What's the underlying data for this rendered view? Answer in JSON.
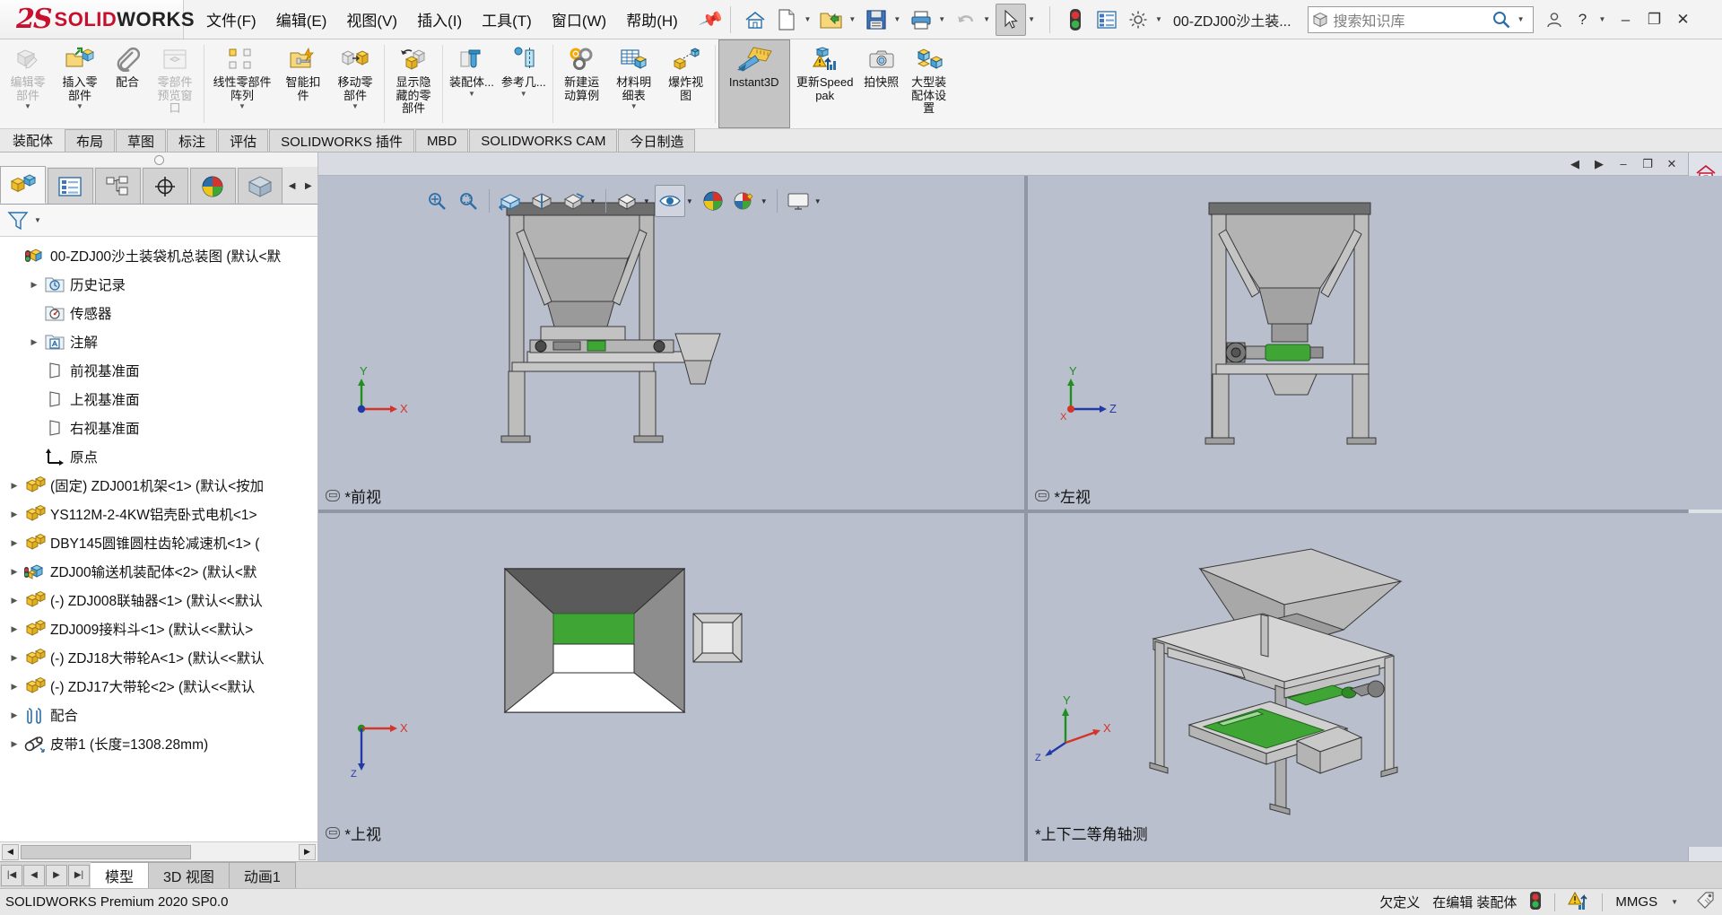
{
  "app": {
    "brand_mark": "2S",
    "brand_a": "SOLID",
    "brand_b": "WORKS",
    "document_title": "00-ZDJ00沙土装...",
    "version_status": "SOLIDWORKS Premium 2020 SP0.0"
  },
  "menu": [
    {
      "label": "文件(F)",
      "name": "menu-file"
    },
    {
      "label": "编辑(E)",
      "name": "menu-edit"
    },
    {
      "label": "视图(V)",
      "name": "menu-view"
    },
    {
      "label": "插入(I)",
      "name": "menu-insert"
    },
    {
      "label": "工具(T)",
      "name": "menu-tools"
    },
    {
      "label": "窗口(W)",
      "name": "menu-window"
    },
    {
      "label": "帮助(H)",
      "name": "menu-help"
    }
  ],
  "quick_access": [
    {
      "name": "home-icon",
      "tooltip": "主页"
    },
    {
      "name": "new-document-icon",
      "tooltip": "新建"
    },
    {
      "name": "open-folder-icon",
      "tooltip": "打开"
    },
    {
      "name": "save-icon",
      "tooltip": "保存"
    },
    {
      "name": "print-icon",
      "tooltip": "打印"
    },
    {
      "name": "undo-icon",
      "tooltip": "撤销"
    },
    {
      "name": "select-arrow-icon",
      "tooltip": "选择"
    },
    {
      "name": "rebuild-icon",
      "tooltip": "重建模型"
    },
    {
      "name": "options-list-icon",
      "tooltip": "显示"
    },
    {
      "name": "gear-icon",
      "tooltip": "选项"
    }
  ],
  "search": {
    "placeholder": "搜索知识库",
    "icon": "box-search-icon"
  },
  "window_controls": {
    "user": "user-icon",
    "help": "help-icon",
    "minimize": "–",
    "maximize": "❐",
    "close": "✕"
  },
  "ribbon": {
    "items": [
      {
        "label": "编辑零部件",
        "name": "ribbon-edit-component",
        "icon": "edit-component-icon",
        "disabled": true,
        "dropdown": true
      },
      {
        "label": "插入零部件",
        "name": "ribbon-insert-component",
        "icon": "insert-component-icon",
        "dropdown": true
      },
      {
        "label": "配合",
        "name": "ribbon-mate",
        "icon": "mate-paperclip-icon",
        "dropdown": false
      },
      {
        "label": "零部件预览窗口",
        "name": "ribbon-component-preview",
        "icon": "component-preview-icon",
        "disabled": true
      },
      {
        "label": "线性零部件阵列",
        "name": "ribbon-linear-pattern",
        "icon": "linear-pattern-icon",
        "dropdown": true
      },
      {
        "label": "智能扣件",
        "name": "ribbon-smart-fasteners",
        "icon": "smart-fastener-icon"
      },
      {
        "label": "移动零部件",
        "name": "ribbon-move-component",
        "icon": "move-component-icon",
        "dropdown": true
      },
      {
        "label": "显示隐藏的零部件",
        "name": "ribbon-show-hidden",
        "icon": "show-hidden-components-icon"
      },
      {
        "label": "装配体...",
        "name": "ribbon-assembly-features",
        "icon": "assembly-feature-icon",
        "dropdown": true
      },
      {
        "label": "参考几...",
        "name": "ribbon-reference-geometry",
        "icon": "reference-geometry-icon",
        "dropdown": true
      },
      {
        "label": "新建运动算例",
        "name": "ribbon-new-motion-study",
        "icon": "motion-study-icon"
      },
      {
        "label": "材料明细表",
        "name": "ribbon-bill-of-materials",
        "icon": "bom-table-icon",
        "dropdown": true
      },
      {
        "label": "爆炸视图",
        "name": "ribbon-exploded-view",
        "icon": "exploded-view-icon"
      },
      {
        "label": "Instant3D",
        "name": "ribbon-instant3d",
        "icon": "instant3d-ruler-icon",
        "active": true
      },
      {
        "label": "更新Speedpak",
        "name": "ribbon-update-speedpak",
        "icon": "update-speedpak-icon"
      },
      {
        "label": "拍快照",
        "name": "ribbon-take-snapshot",
        "icon": "camera-icon"
      },
      {
        "label": "大型装配体设置",
        "name": "ribbon-large-assembly-settings",
        "icon": "large-assembly-icon"
      }
    ]
  },
  "command_tabs": [
    {
      "label": "装配体",
      "name": "tab-assembly",
      "selected": false,
      "plain": true
    },
    {
      "label": "布局",
      "name": "tab-layout",
      "selected": false
    },
    {
      "label": "草图",
      "name": "tab-sketch",
      "selected": false
    },
    {
      "label": "标注",
      "name": "tab-markup",
      "selected": false
    },
    {
      "label": "评估",
      "name": "tab-evaluate",
      "selected": false
    },
    {
      "label": "SOLIDWORKS 插件",
      "name": "tab-solidworks-addins",
      "selected": false
    },
    {
      "label": "MBD",
      "name": "tab-mbd",
      "selected": false
    },
    {
      "label": "SOLIDWORKS CAM",
      "name": "tab-solidworks-cam",
      "selected": false
    },
    {
      "label": "今日制造",
      "name": "tab-manufacturing-today",
      "selected": false
    }
  ],
  "left_panel": {
    "tabs": [
      {
        "name": "feature-manager-tab",
        "icon": "assembly-tree-icon",
        "selected": true
      },
      {
        "name": "property-manager-tab",
        "icon": "property-list-icon",
        "selected": false
      },
      {
        "name": "configuration-manager-tab",
        "icon": "configuration-icon",
        "selected": false
      },
      {
        "name": "dimxpert-manager-tab",
        "icon": "dimxpert-target-icon",
        "selected": false
      },
      {
        "name": "display-manager-tab",
        "icon": "display-sphere-icon",
        "selected": false
      },
      {
        "name": "appearance-tab",
        "icon": "appearance-cube-icon",
        "selected": false
      }
    ],
    "filter": {
      "name": "filter-funnel-icon",
      "label": ""
    },
    "tree": [
      {
        "label": "00-ZDJ00沙土装袋机总装图  (默认<默",
        "icon": "assembly-root-icon",
        "arrow": false,
        "level": 0,
        "name": "tree-root"
      },
      {
        "label": "历史记录",
        "icon": "history-folder-icon",
        "arrow": true,
        "level": 1,
        "name": "tree-history"
      },
      {
        "label": "传感器",
        "icon": "sensors-folder-icon",
        "arrow": false,
        "level": 1,
        "name": "tree-sensors"
      },
      {
        "label": "注解",
        "icon": "annotations-folder-icon",
        "arrow": true,
        "level": 1,
        "name": "tree-annotations"
      },
      {
        "label": "前视基准面",
        "icon": "plane-icon",
        "arrow": false,
        "level": 1,
        "name": "tree-front-plane"
      },
      {
        "label": "上视基准面",
        "icon": "plane-icon",
        "arrow": false,
        "level": 1,
        "name": "tree-top-plane"
      },
      {
        "label": "右视基准面",
        "icon": "plane-icon",
        "arrow": false,
        "level": 1,
        "name": "tree-right-plane"
      },
      {
        "label": "原点",
        "icon": "origin-icon",
        "arrow": false,
        "level": 1,
        "name": "tree-origin"
      },
      {
        "label": "(固定) ZDJ001机架<1> (默认<按加",
        "icon": "part-icon",
        "arrow": true,
        "level": 0,
        "name": "tree-part-frame"
      },
      {
        "label": "YS112M-2-4KW铝壳卧式电机<1>",
        "icon": "part-icon",
        "arrow": true,
        "level": 0,
        "name": "tree-part-motor"
      },
      {
        "label": "DBY145圆锥圆柱齿轮减速机<1> (",
        "icon": "part-icon",
        "arrow": true,
        "level": 0,
        "name": "tree-part-reducer"
      },
      {
        "label": "ZDJ00输送机装配体<2> (默认<默",
        "icon": "subassembly-icon",
        "arrow": true,
        "level": 0,
        "name": "tree-subassembly-conveyor"
      },
      {
        "label": "(-) ZDJ008联轴器<1> (默认<<默认",
        "icon": "part-icon",
        "arrow": true,
        "level": 0,
        "name": "tree-part-coupling"
      },
      {
        "label": "ZDJ009接料斗<1> (默认<<默认>",
        "icon": "part-icon",
        "arrow": true,
        "level": 0,
        "name": "tree-part-hopper"
      },
      {
        "label": "(-) ZDJ18大带轮A<1> (默认<<默认",
        "icon": "part-icon",
        "arrow": true,
        "level": 0,
        "name": "tree-part-pulley-a"
      },
      {
        "label": "(-) ZDJ17大带轮<2> (默认<<默认",
        "icon": "part-icon",
        "arrow": true,
        "level": 0,
        "name": "tree-part-pulley"
      },
      {
        "label": "配合",
        "icon": "mates-folder-icon",
        "arrow": true,
        "level": 0,
        "name": "tree-mates"
      },
      {
        "label": "皮带1 (长度=1308.28mm)",
        "icon": "belt-icon",
        "arrow": true,
        "level": 0,
        "name": "tree-belt"
      }
    ]
  },
  "heads_up_toolbar": [
    {
      "name": "zoom-to-fit-icon"
    },
    {
      "name": "zoom-to-area-icon"
    },
    {
      "name": "previous-view-icon"
    },
    {
      "name": "section-view-icon"
    },
    {
      "name": "view-orientation-icon"
    },
    {
      "name": "display-style-icon"
    },
    {
      "name": "hide-show-items-icon"
    },
    {
      "name": "edit-appearance-icon"
    },
    {
      "name": "apply-scene-icon"
    },
    {
      "name": "view-settings-icon"
    }
  ],
  "viewports": [
    {
      "name": "viewport-front",
      "label": "*前视",
      "locked": true
    },
    {
      "name": "viewport-left",
      "label": "*左视",
      "locked": true
    },
    {
      "name": "viewport-top",
      "label": "*上视",
      "locked": true
    },
    {
      "name": "viewport-isometric",
      "label": "*上下二等角轴测",
      "locked": false
    }
  ],
  "triads": [
    {
      "viewport": "front",
      "axes": [
        "Y",
        "X"
      ]
    },
    {
      "viewport": "left",
      "axes": [
        "Y",
        "Z",
        "X"
      ]
    },
    {
      "viewport": "top",
      "axes": [
        "X",
        "Z"
      ]
    },
    {
      "viewport": "iso",
      "axes": [
        "Y",
        "X",
        "Z"
      ]
    }
  ],
  "task_pane": [
    {
      "name": "home-task-icon"
    },
    {
      "name": "design-library-icon"
    },
    {
      "name": "file-explorer-icon"
    },
    {
      "name": "view-palette-icon"
    },
    {
      "name": "appearances-scenes-icon"
    },
    {
      "name": "custom-properties-icon"
    },
    {
      "name": "solidworks-forum-icon"
    }
  ],
  "bottom_tabs": [
    {
      "label": "模型",
      "name": "bottom-tab-model",
      "selected": true
    },
    {
      "label": "3D 视图",
      "name": "bottom-tab-3dviews",
      "selected": false
    },
    {
      "label": "动画1",
      "name": "bottom-tab-animation1",
      "selected": false
    }
  ],
  "status_bar": {
    "left": "SOLIDWORKS Premium 2020 SP0.0",
    "under_defined": "欠定义",
    "editing": "在编辑 装配体",
    "units": "MMGS",
    "rebuild_icon": "rebuild-traffic-light-icon",
    "warning_icon": "warning-performance-icon",
    "tag_icon": "tag-icon"
  },
  "window_tools": {
    "prev": "◀",
    "next": "▶",
    "minimize": "–",
    "restore": "❐",
    "close": "✕"
  },
  "colors": {
    "brand_red": "#c8102e",
    "viewport_bg": "#b9bfcd",
    "accent_green": "#3fa535",
    "steel_gray": "#9a9a9a",
    "hopper_dark": "#6f6f6f"
  }
}
